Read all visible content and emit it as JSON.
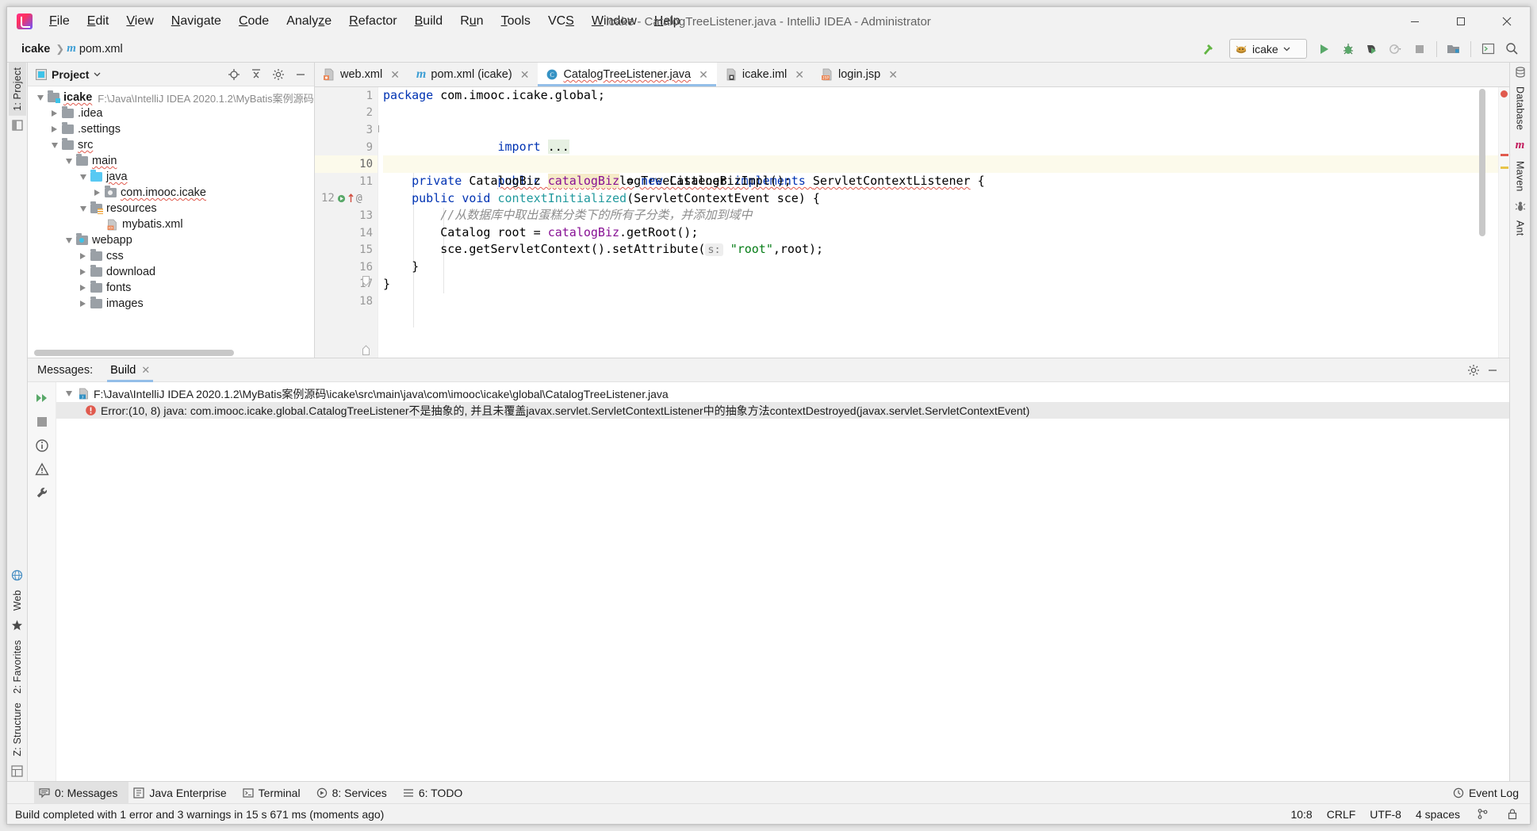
{
  "window": {
    "title": "icake - CatalogTreeListener.java - IntelliJ IDEA - Administrator",
    "minimize_label": "Minimize",
    "maximize_label": "Maximize",
    "close_label": "Close"
  },
  "menubar": {
    "items": [
      {
        "label": "File",
        "mnemonic": "F"
      },
      {
        "label": "Edit",
        "mnemonic": "E"
      },
      {
        "label": "View",
        "mnemonic": "V"
      },
      {
        "label": "Navigate",
        "mnemonic": "N"
      },
      {
        "label": "Code",
        "mnemonic": "C"
      },
      {
        "label": "Analyze",
        "mnemonic": "z"
      },
      {
        "label": "Refactor",
        "mnemonic": "R"
      },
      {
        "label": "Build",
        "mnemonic": "B"
      },
      {
        "label": "Run",
        "mnemonic": "u"
      },
      {
        "label": "Tools",
        "mnemonic": "T"
      },
      {
        "label": "VCS",
        "mnemonic": "S"
      },
      {
        "label": "Window",
        "mnemonic": "W"
      },
      {
        "label": "Help",
        "mnemonic": "H"
      }
    ]
  },
  "navbar": {
    "breadcrumb": [
      "icake",
      "pom.xml"
    ],
    "project_label": "icake",
    "file_label": "pom.xml",
    "run_config": "icake",
    "toolbar_icons": [
      "build-hammer-icon",
      "run-icon",
      "debug-icon",
      "run-with-coverage-icon",
      "profiler-icon",
      "stop-icon",
      "open-folder-icon",
      "terminal-icon",
      "search-everywhere-icon"
    ]
  },
  "project_panel": {
    "title": "Project",
    "header_icons": [
      "locate-icon",
      "collapse-all-icon",
      "gear-icon",
      "hide-icon"
    ],
    "tree": [
      {
        "depth": 0,
        "label": "icake",
        "path": "F:\\Java\\IntelliJ IDEA 2020.1.2\\MyBatis案例源码",
        "icon": "module-folder-icon",
        "state": "open",
        "bold": true,
        "wavy": true
      },
      {
        "depth": 1,
        "label": ".idea",
        "path": "",
        "icon": "folder-icon",
        "state": "closed",
        "bold": false,
        "wavy": false
      },
      {
        "depth": 1,
        "label": ".settings",
        "path": "",
        "icon": "folder-icon",
        "state": "closed",
        "bold": false,
        "wavy": false
      },
      {
        "depth": 1,
        "label": "src",
        "path": "",
        "icon": "folder-icon",
        "state": "open",
        "bold": false,
        "wavy": true
      },
      {
        "depth": 2,
        "label": "main",
        "path": "",
        "icon": "folder-icon",
        "state": "open",
        "bold": false,
        "wavy": true
      },
      {
        "depth": 3,
        "label": "java",
        "path": "",
        "icon": "source-folder-icon",
        "state": "open",
        "bold": false,
        "wavy": true
      },
      {
        "depth": 4,
        "label": "com.imooc.icake",
        "path": "",
        "icon": "package-icon",
        "state": "closed",
        "bold": false,
        "wavy": true
      },
      {
        "depth": 3,
        "label": "resources",
        "path": "",
        "icon": "resources-folder-icon",
        "state": "open",
        "bold": false,
        "wavy": false
      },
      {
        "depth": 4,
        "label": "mybatis.xml",
        "path": "",
        "icon": "xml-file-icon",
        "state": "leaf",
        "bold": false,
        "wavy": false
      },
      {
        "depth": 2,
        "label": "webapp",
        "path": "",
        "icon": "webapp-folder-icon",
        "state": "open",
        "bold": false,
        "wavy": false
      },
      {
        "depth": 3,
        "label": "css",
        "path": "",
        "icon": "folder-icon",
        "state": "closed",
        "bold": false,
        "wavy": false
      },
      {
        "depth": 3,
        "label": "download",
        "path": "",
        "icon": "folder-icon",
        "state": "closed",
        "bold": false,
        "wavy": false
      },
      {
        "depth": 3,
        "label": "fonts",
        "path": "",
        "icon": "folder-icon",
        "state": "closed",
        "bold": false,
        "wavy": false
      },
      {
        "depth": 3,
        "label": "images",
        "path": "",
        "icon": "folder-icon",
        "state": "closed",
        "bold": false,
        "wavy": false
      }
    ]
  },
  "editor": {
    "tabs": [
      {
        "label": "web.xml",
        "icon": "xml-file-icon",
        "active": false,
        "error": false
      },
      {
        "label": "pom.xml (icake)",
        "icon": "maven-file-icon",
        "active": false,
        "error": false
      },
      {
        "label": "CatalogTreeListener.java",
        "icon": "java-class-icon",
        "active": true,
        "error": true
      },
      {
        "label": "icake.iml",
        "icon": "iml-file-icon",
        "active": false,
        "error": false
      },
      {
        "label": "login.jsp",
        "icon": "jsp-file-icon",
        "active": false,
        "error": false
      }
    ],
    "line_numbers": [
      "1",
      "2",
      "3",
      "9",
      "10",
      "11",
      "12",
      "13",
      "14",
      "15",
      "16",
      "17",
      "18"
    ],
    "current_line_number": "10",
    "code_lines": [
      {
        "num": "1",
        "segments": [
          {
            "t": "package",
            "c": "kw"
          },
          {
            "t": " com.imooc.icake.global;",
            "c": "cls"
          }
        ]
      },
      {
        "num": "2",
        "segments": []
      },
      {
        "num": "3",
        "segments": [
          {
            "t": "import",
            "c": "kw"
          },
          {
            "t": " ",
            "c": "cls"
          },
          {
            "t": "...",
            "c": "hl-import"
          }
        ],
        "fold": true
      },
      {
        "num": "9",
        "segments": []
      },
      {
        "num": "10",
        "segments": [
          {
            "t": "public class ",
            "c": "kw-err"
          },
          {
            "t": "CatalogTreeListener ",
            "c": "cls-err"
          },
          {
            "t": "implements ",
            "c": "kw-err"
          },
          {
            "t": "ServletContextListener",
            "c": "cls-err"
          },
          {
            "t": " {",
            "c": "cls"
          }
        ],
        "current": true
      },
      {
        "num": "11",
        "segments": [
          {
            "t": "    ",
            "c": "cls"
          },
          {
            "t": "private",
            "c": "kw"
          },
          {
            "t": " CatalogBiz ",
            "c": "cls"
          },
          {
            "t": "catalogBiz",
            "c": "fld-hl"
          },
          {
            "t": " = ",
            "c": "cls"
          },
          {
            "t": "new",
            "c": "kw"
          },
          {
            "t": " CatalogBizImpl();",
            "c": "cls"
          }
        ]
      },
      {
        "num": "12",
        "segments": [
          {
            "t": "    ",
            "c": "cls"
          },
          {
            "t": "public",
            "c": "kw"
          },
          {
            "t": " ",
            "c": "cls"
          },
          {
            "t": "void",
            "c": "kw"
          },
          {
            "t": " ",
            "c": "cls"
          },
          {
            "t": "contextInitialized",
            "c": "type"
          },
          {
            "t": "(ServletContextEvent sce) {",
            "c": "cls"
          }
        ],
        "gutter_marks": [
          "run-method-icon",
          "override-arrow-icon",
          "annotation-icon"
        ],
        "fold_end": true
      },
      {
        "num": "13",
        "segments": [
          {
            "t": "        ",
            "c": "cls"
          },
          {
            "t": "//从数据库中取出蛋糕分类下的所有子分类，并添加到域中",
            "c": "cmt"
          }
        ]
      },
      {
        "num": "14",
        "segments": [
          {
            "t": "        Catalog root = ",
            "c": "cls"
          },
          {
            "t": "catalogBiz",
            "c": "fld"
          },
          {
            "t": ".getRoot();",
            "c": "cls"
          }
        ]
      },
      {
        "num": "15",
        "segments": [
          {
            "t": "        sce.getServletContext().setAttribute(",
            "c": "cls"
          },
          {
            "t": "s:",
            "c": "hint"
          },
          {
            "t": " ",
            "c": "cls"
          },
          {
            "t": "\"root\"",
            "c": "str"
          },
          {
            "t": ",root);",
            "c": "cls"
          }
        ]
      },
      {
        "num": "16",
        "segments": [
          {
            "t": "    }",
            "c": "cls"
          }
        ],
        "fold_end_mark": true
      },
      {
        "num": "17",
        "segments": [
          {
            "t": "}",
            "c": "cls"
          }
        ]
      },
      {
        "num": "18",
        "segments": []
      }
    ]
  },
  "messages_panel": {
    "label": "Messages:",
    "tab": "Build",
    "rows": [
      {
        "depth": 0,
        "text": "F:\\Java\\IntelliJ IDEA 2020.1.2\\MyBatis案例源码\\icake\\src\\main\\java\\com\\imooc\\icake\\global\\CatalogTreeListener.java",
        "icon": "java-file-icon",
        "type": "file",
        "selected": false
      },
      {
        "depth": 1,
        "text": "Error:(10, 8)  java: com.imooc.icake.global.CatalogTreeListener不是抽象的, 并且未覆盖javax.servlet.ServletContextListener中的抽象方法contextDestroyed(javax.servlet.ServletContextEvent)",
        "icon": "error-icon",
        "type": "error",
        "selected": true
      }
    ],
    "rail_icons": [
      "rerun-icon",
      "stop-icon",
      "info-icon",
      "warning-icon",
      "settings-wrench-icon"
    ],
    "head_icons": [
      "gear-icon",
      "hide-icon"
    ]
  },
  "left_tool_strip": {
    "top": [
      {
        "label": "1: Project",
        "active": true
      }
    ],
    "bottom": [
      {
        "label": "Web",
        "icon": "web-icon"
      },
      {
        "label": "2: Favorites",
        "icon": "star-icon"
      },
      {
        "label": "Z: Structure",
        "icon": "structure-icon"
      }
    ]
  },
  "right_tool_strip": {
    "items": [
      {
        "label": "Database",
        "icon": "database-icon"
      },
      {
        "label": "Maven",
        "icon": "maven-icon"
      },
      {
        "label": "Ant",
        "icon": "ant-icon"
      }
    ]
  },
  "bottom_bar": {
    "tabs": [
      {
        "label": "0: Messages",
        "icon": "messages-icon",
        "active": true
      },
      {
        "label": "Java Enterprise",
        "icon": "java-ee-icon",
        "active": false
      },
      {
        "label": "Terminal",
        "icon": "terminal-icon",
        "active": false
      },
      {
        "label": "8: Services",
        "icon": "services-icon",
        "active": false
      },
      {
        "label": "6: TODO",
        "icon": "todo-icon",
        "active": false
      }
    ],
    "event_log": "Event Log"
  },
  "statusbar": {
    "message": "Build completed with 1 error and 3 warnings in 15 s 671 ms (moments ago)",
    "caret": "10:8",
    "line_separator": "CRLF",
    "encoding": "UTF-8",
    "indent": "4 spaces",
    "icons": [
      "branch-icon",
      "lock-icon"
    ]
  },
  "colors": {
    "accent_blue": "#93bee8",
    "error_red": "#e05a4e",
    "keyword_blue": "#0033b3",
    "string_green": "#067d17",
    "field_purple": "#871094",
    "method_teal": "#20999d",
    "current_line": "#fcfaeb",
    "ide_bg": "#f2f2f2"
  }
}
